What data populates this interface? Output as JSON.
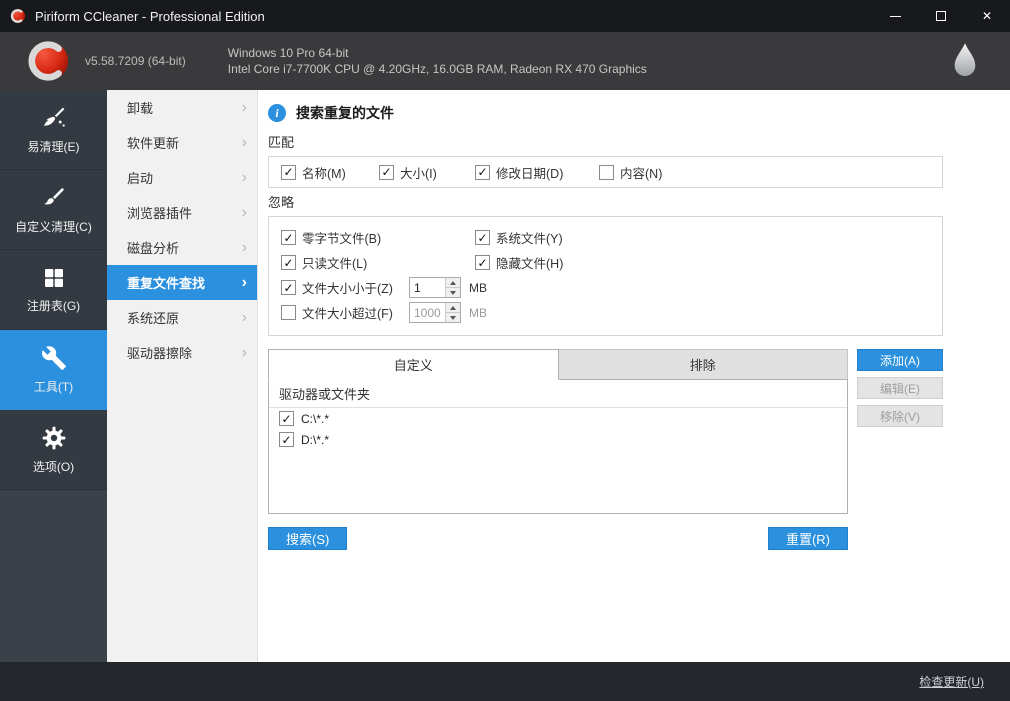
{
  "colors": {
    "accent": "#2b90dd",
    "logo_red": "#d92a14"
  },
  "window": {
    "title": "Piriform CCleaner - Professional Edition"
  },
  "header": {
    "version": "v5.58.7209 (64-bit)",
    "os": "Windows 10 Pro 64-bit",
    "hardware": "Intel Core i7-7700K CPU @ 4.20GHz, 16.0GB RAM, Radeon RX 470 Graphics"
  },
  "sidebar": {
    "items": [
      {
        "label": "易清理(E)",
        "icon": "broom-icon",
        "active": false
      },
      {
        "label": "自定义清理(C)",
        "icon": "brush-icon",
        "active": false
      },
      {
        "label": "注册表(G)",
        "icon": "registry-grid-icon",
        "active": false
      },
      {
        "label": "工具(T)",
        "icon": "wrench-icon",
        "active": true
      },
      {
        "label": "选项(O)",
        "icon": "gear-icon",
        "active": false
      }
    ]
  },
  "tools_menu": {
    "items": [
      {
        "label": "卸载",
        "active": false
      },
      {
        "label": "软件更新",
        "active": false
      },
      {
        "label": "启动",
        "active": false
      },
      {
        "label": "浏览器插件",
        "active": false
      },
      {
        "label": "磁盘分析",
        "active": false
      },
      {
        "label": "重复文件查找",
        "active": true
      },
      {
        "label": "系统还原",
        "active": false
      },
      {
        "label": "驱动器擦除",
        "active": false
      }
    ]
  },
  "main": {
    "title": "搜索重复的文件",
    "match": {
      "label": "匹配",
      "options": [
        {
          "label": "名称(M)",
          "checked": true
        },
        {
          "label": "大小(I)",
          "checked": true
        },
        {
          "label": "修改日期(D)",
          "checked": true
        },
        {
          "label": "内容(N)",
          "checked": false
        }
      ]
    },
    "ignore": {
      "label": "忽略",
      "options": [
        {
          "label": "零字节文件(B)",
          "checked": true
        },
        {
          "label": "系统文件(Y)",
          "checked": true
        },
        {
          "label": "只读文件(L)",
          "checked": true
        },
        {
          "label": "隐藏文件(H)",
          "checked": true
        }
      ],
      "size_filters": [
        {
          "label": "文件大小小于(Z)",
          "checked": true,
          "value": "1",
          "unit": "MB"
        },
        {
          "label": "文件大小超过(F)",
          "checked": false,
          "value": "1000",
          "unit": "MB"
        }
      ]
    },
    "tabs": [
      {
        "label": "自定义",
        "active": true
      },
      {
        "label": "排除",
        "active": false
      }
    ],
    "list_buttons": [
      {
        "label": "添加(A)",
        "enabled": true
      },
      {
        "label": "编辑(E)",
        "enabled": false
      },
      {
        "label": "移除(V)",
        "enabled": false
      }
    ],
    "table": {
      "header": "驱动器或文件夹",
      "rows": [
        {
          "path": "C:\\*.*",
          "checked": true
        },
        {
          "path": "D:\\*.*",
          "checked": true
        }
      ]
    },
    "search_button": "搜索(S)",
    "reset_button": "重置(R)"
  },
  "footer": {
    "update_link": "检查更新(U)"
  }
}
